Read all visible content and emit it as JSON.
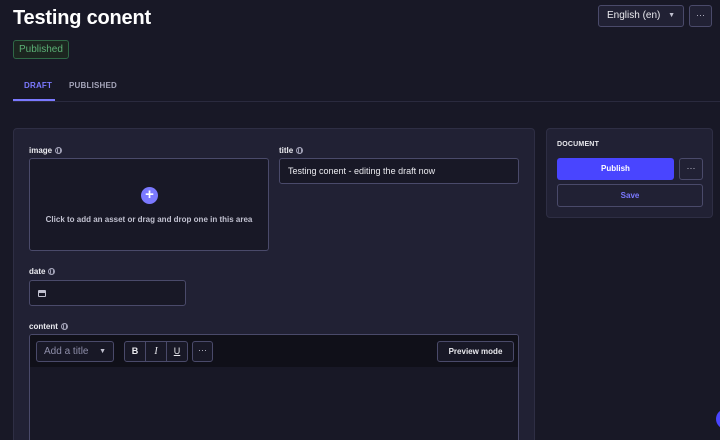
{
  "header": {
    "title": "Testing conent",
    "status": "Published",
    "locale": "English (en)",
    "more_label": "···"
  },
  "tabs": [
    {
      "label": "DRAFT",
      "active": true
    },
    {
      "label": "PUBLISHED",
      "active": false
    }
  ],
  "fields": {
    "image": {
      "label": "image",
      "dropzone_text": "Click to add an asset or drag and drop one in this area"
    },
    "title": {
      "label": "title",
      "value": "Testing conent - editing the draft now"
    },
    "date": {
      "label": "date",
      "value": ""
    },
    "content": {
      "label": "content",
      "heading_placeholder": "Add a title",
      "bold": "B",
      "italic": "I",
      "underline": "U",
      "more_label": "···",
      "preview_label": "Preview mode"
    }
  },
  "sidebar": {
    "heading": "DOCUMENT",
    "publish_label": "Publish",
    "more_label": "···",
    "save_label": "Save"
  },
  "icons": {
    "locale_chevron": "chevron-down-icon",
    "globe": "globe-icon",
    "add_asset": "plus-circle-icon",
    "calendar": "calendar-icon"
  },
  "colors": {
    "accent": "#7b79ff",
    "primary_button": "#4945ff",
    "published_badge": "#5cb176",
    "background": "#181826",
    "card": "#212134"
  }
}
